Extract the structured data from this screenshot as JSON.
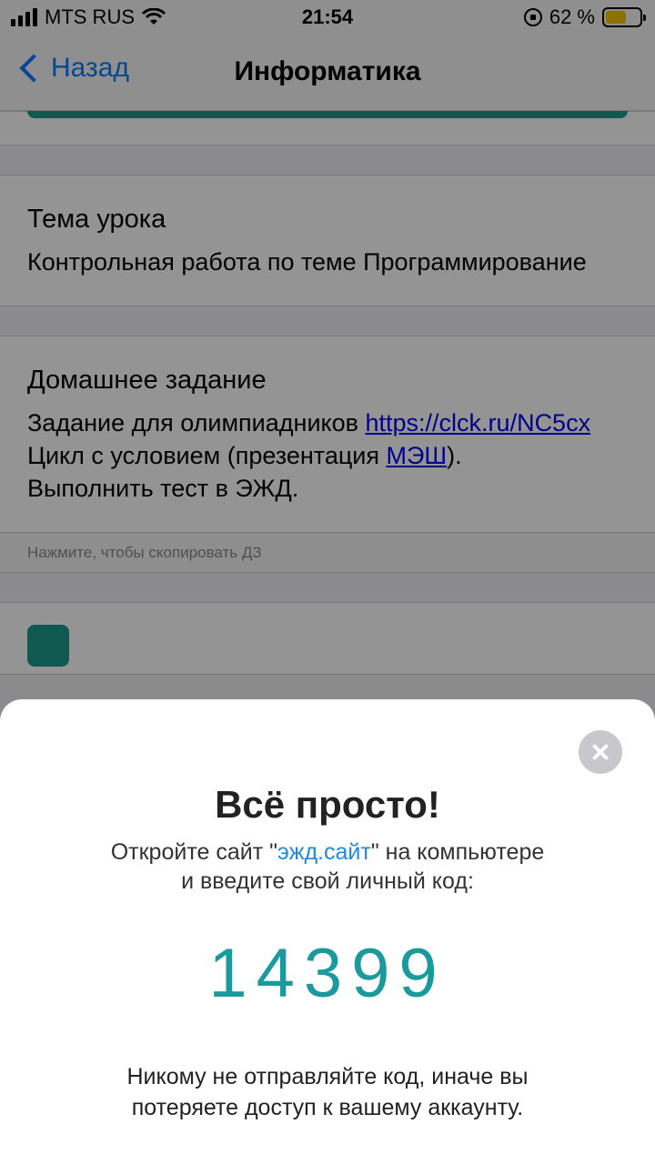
{
  "status_bar": {
    "carrier": "MTS RUS",
    "time": "21:54",
    "battery": "62 %",
    "battery_level": 0.62
  },
  "nav": {
    "back_label": "Назад",
    "title": "Информатика"
  },
  "lesson_topic": {
    "heading": "Тема урока",
    "text": "Контрольная работа по теме Программирование"
  },
  "homework": {
    "heading": "Домашнее задание",
    "line1_text": "Задание для олимпиадников ",
    "line1_link": "https://clck.ru/NC5cx",
    "line2_text": "Цикл с условием (презентация ",
    "line2_link": "МЭШ",
    "line2_tail": ").",
    "line3": "Выполнить тест в ЭЖД."
  },
  "hint": "Нажмите, чтобы скопировать ДЗ",
  "sheet": {
    "title": "Всё просто!",
    "text_before": "Откройте сайт \"",
    "site": "эжд.сайт",
    "text_after": "\" на компьютере",
    "text_line2": "и введите свой личный код:",
    "code": "14399",
    "warning_line1": "Никому не отправляйте код, иначе вы",
    "warning_line2": "потеряете доступ к вашему аккаунту."
  },
  "colors": {
    "accent": "#0a7aff",
    "teal": "#1a9a9c",
    "link": "#1e88e5"
  }
}
